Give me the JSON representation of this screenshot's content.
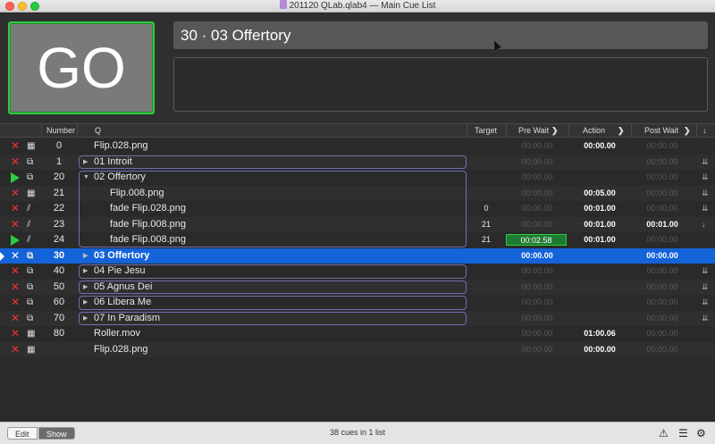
{
  "window": {
    "title": "201120 QLab.qlab4 — Main Cue List"
  },
  "go_button": {
    "label": "GO"
  },
  "standby": {
    "cue_label": "30 · 03 Offertory",
    "notes": ""
  },
  "columns": {
    "number": "Number",
    "q": "Q",
    "target": "Target",
    "pre_wait": "Pre Wait",
    "action": "Action",
    "post_wait": "Post Wait"
  },
  "rows": [
    {
      "status": "broken",
      "type": "video",
      "number": "0",
      "name": "Flip.028.png",
      "target": "",
      "pre": "00:00.00",
      "pre_lit": false,
      "action": "00:00.00",
      "action_lit": true,
      "post": "00:00.00",
      "post_lit": false,
      "cont": ""
    },
    {
      "status": "broken",
      "type": "group",
      "number": "1",
      "name": "01 Introit",
      "group": true,
      "expanded": false,
      "target": "",
      "pre": "00:00.00",
      "pre_lit": false,
      "action": "",
      "action_lit": false,
      "post": "00:00.00",
      "post_lit": false,
      "cont": "auto"
    },
    {
      "status": "running",
      "type": "group",
      "number": "20",
      "name": "02 Offertory",
      "group": true,
      "expanded": true,
      "target": "",
      "pre": "00:00.00",
      "pre_lit": false,
      "action": "",
      "action_lit": false,
      "post": "00:00.00",
      "post_lit": false,
      "cont": "auto"
    },
    {
      "status": "broken",
      "type": "video",
      "number": "21",
      "name": "Flip.008.png",
      "child": true,
      "target": "",
      "pre": "00:00.00",
      "pre_lit": false,
      "action": "00:05.00",
      "action_lit": true,
      "post": "00:00.00",
      "post_lit": false,
      "cont": "auto"
    },
    {
      "status": "broken",
      "type": "fade",
      "number": "22",
      "name": "fade Flip.028.png",
      "child": true,
      "target": "0",
      "pre": "00:00.00",
      "pre_lit": false,
      "action": "00:01.00",
      "action_lit": true,
      "post": "00:00.00",
      "post_lit": false,
      "cont": "auto"
    },
    {
      "status": "broken",
      "type": "fade",
      "number": "23",
      "name": "fade Flip.008.png",
      "child": true,
      "target": "21",
      "pre": "00:00.00",
      "pre_lit": false,
      "action": "00:01.00",
      "action_lit": true,
      "post": "00:01.00",
      "post_lit": true,
      "cont": "follow"
    },
    {
      "status": "running",
      "type": "fade",
      "number": "24",
      "name": "fade Flip.008.png",
      "child": true,
      "target": "21",
      "pre": "00:02.58",
      "pre_running": true,
      "action": "00:01.00",
      "action_lit": true,
      "post": "00:00.00",
      "post_lit": false,
      "cont": ""
    },
    {
      "status": "standby",
      "type": "group",
      "number": "30",
      "name": "03 Offertory",
      "group": true,
      "expanded": false,
      "selected": true,
      "target": "",
      "pre": "00:00.00",
      "pre_lit": true,
      "action": "",
      "action_lit": false,
      "post": "00:00.00",
      "post_lit": true,
      "cont": ""
    },
    {
      "status": "broken",
      "type": "group",
      "number": "40",
      "name": "04 Pie Jesu",
      "group": true,
      "expanded": false,
      "target": "",
      "pre": "00:00.00",
      "pre_lit": false,
      "action": "",
      "action_lit": false,
      "post": "00:00.00",
      "post_lit": false,
      "cont": "auto"
    },
    {
      "status": "broken",
      "type": "group",
      "number": "50",
      "name": "05 Agnus Dei",
      "group": true,
      "expanded": false,
      "target": "",
      "pre": "00:00.00",
      "pre_lit": false,
      "action": "",
      "action_lit": false,
      "post": "00:00.00",
      "post_lit": false,
      "cont": "auto"
    },
    {
      "status": "broken",
      "type": "group",
      "number": "60",
      "name": "06 Libera Me",
      "group": true,
      "expanded": false,
      "target": "",
      "pre": "00:00.00",
      "pre_lit": false,
      "action": "",
      "action_lit": false,
      "post": "00:00.00",
      "post_lit": false,
      "cont": "auto"
    },
    {
      "status": "broken",
      "type": "group",
      "number": "70",
      "name": "07 In Paradism",
      "group": true,
      "expanded": false,
      "target": "",
      "pre": "00:00.00",
      "pre_lit": false,
      "action": "",
      "action_lit": false,
      "post": "00:00.00",
      "post_lit": false,
      "cont": "auto"
    },
    {
      "status": "broken",
      "type": "video",
      "number": "80",
      "name": "Roller.mov",
      "target": "",
      "pre": "00:00.00",
      "pre_lit": false,
      "action": "01:00.06",
      "action_lit": true,
      "post": "00:00.00",
      "post_lit": false,
      "cont": ""
    },
    {
      "status": "broken",
      "type": "video",
      "number": "",
      "name": "Flip.028.png",
      "target": "",
      "pre": "00:00.00",
      "pre_lit": false,
      "action": "00:00.00",
      "action_lit": true,
      "post": "00:00.00",
      "post_lit": false,
      "cont": ""
    }
  ],
  "footer": {
    "edit_label": "Edit",
    "show_label": "Show",
    "status": "38 cues in 1 list"
  },
  "icons": {
    "broken": "x-icon",
    "running": "play-icon",
    "video": "film-icon",
    "group": "group-icon",
    "fade": "fade-icon",
    "warning": "warning-icon",
    "lists": "list-icon",
    "settings": "gear-icon"
  },
  "colors": {
    "selected_row": "#1463d9",
    "running_green": "#2ecc40",
    "broken_red": "#e33333",
    "group_outline": "#6f6fb0"
  }
}
